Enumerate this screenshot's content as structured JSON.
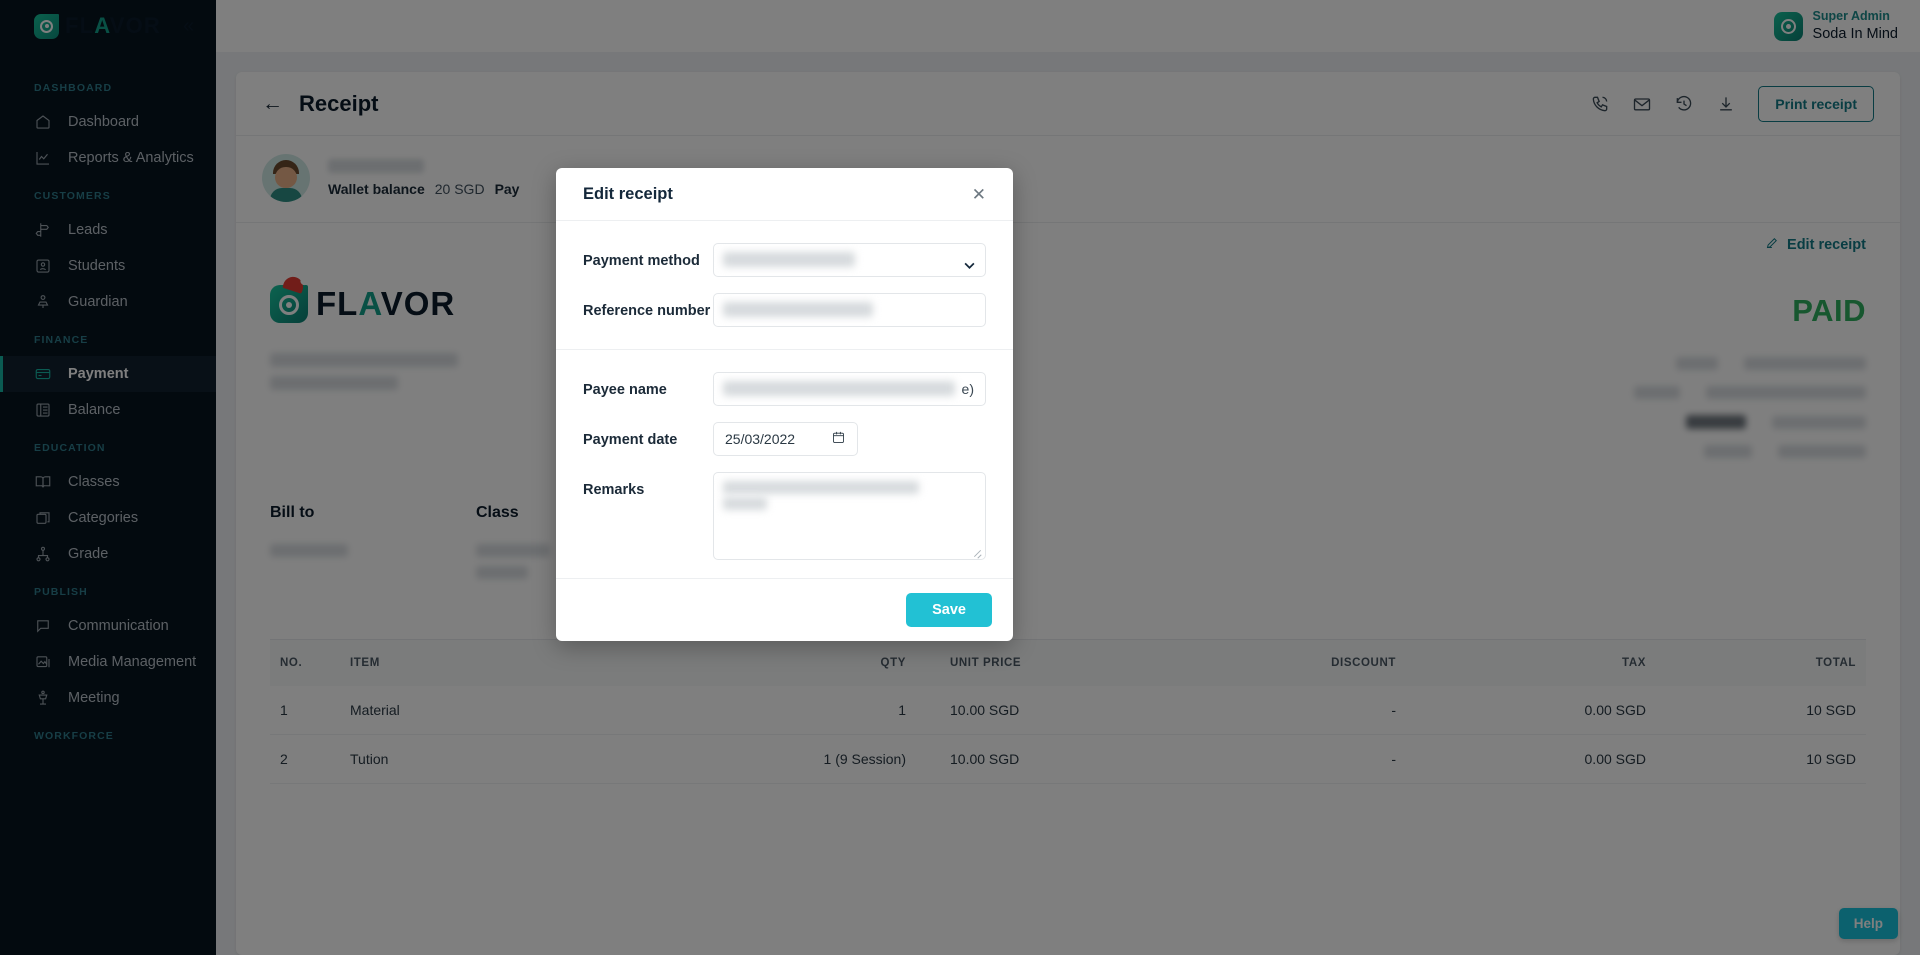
{
  "brand": {
    "name_prefix": "FL",
    "name_accent": "A",
    "name_suffix": "VOR",
    "collapse_glyph": "«"
  },
  "topbar": {
    "user_role": "Super Admin",
    "user_name": "Soda In Mind"
  },
  "sidebar": {
    "groups": [
      {
        "label": "DASHBOARD",
        "items": [
          {
            "label": "Dashboard",
            "icon": "home-icon",
            "active": false
          },
          {
            "label": "Reports & Analytics",
            "icon": "chart-icon",
            "active": false
          }
        ]
      },
      {
        "label": "CUSTOMERS",
        "items": [
          {
            "label": "Leads",
            "icon": "signpost-icon",
            "active": false
          },
          {
            "label": "Students",
            "icon": "id-card-icon",
            "active": false
          },
          {
            "label": "Guardian",
            "icon": "guardian-icon",
            "active": false
          }
        ]
      },
      {
        "label": "FINANCE",
        "items": [
          {
            "label": "Payment",
            "icon": "credit-card-icon",
            "active": true
          },
          {
            "label": "Balance",
            "icon": "ledger-icon",
            "active": false
          }
        ]
      },
      {
        "label": "EDUCATION",
        "items": [
          {
            "label": "Classes",
            "icon": "book-icon",
            "active": false
          },
          {
            "label": "Categories",
            "icon": "boxes-icon",
            "active": false
          },
          {
            "label": "Grade",
            "icon": "hierarchy-icon",
            "active": false
          }
        ]
      },
      {
        "label": "PUBLISH",
        "items": [
          {
            "label": "Communication",
            "icon": "chat-icon",
            "active": false
          },
          {
            "label": "Media Management",
            "icon": "image-icon",
            "active": false
          },
          {
            "label": "Meeting",
            "icon": "podium-icon",
            "active": false
          }
        ]
      },
      {
        "label": "WORKFORCE",
        "items": []
      }
    ]
  },
  "receipt_page": {
    "title": "Receipt",
    "back_icon": "back-arrow-icon",
    "actions": [
      {
        "icon": "phone-icon",
        "name": "call-icon"
      },
      {
        "icon": "mail-icon",
        "name": "email-icon"
      },
      {
        "icon": "history-icon",
        "name": "history-icon"
      },
      {
        "icon": "download-icon",
        "name": "download-icon"
      }
    ],
    "print_button": "Print receipt",
    "customer": {
      "wallet_label": "Wallet balance",
      "wallet_value": "20 SGD",
      "payment_label": "Pay"
    },
    "edit_receipt_link": "Edit receipt",
    "status_badge": "PAID",
    "bill_to_title": "Bill to",
    "class_title": "Class",
    "help_button": "Help"
  },
  "items_table": {
    "columns": [
      "NO.",
      "ITEM",
      "QTY",
      "UNIT PRICE",
      "DISCOUNT",
      "TAX",
      "TOTAL"
    ],
    "rows": [
      {
        "no": "1",
        "item": "Material",
        "qty": "1",
        "unit_price": "10.00 SGD",
        "discount": "-",
        "tax": "0.00 SGD",
        "total": "10 SGD"
      },
      {
        "no": "2",
        "item": "Tution",
        "qty": "1 (9 Session)",
        "unit_price": "10.00 SGD",
        "discount": "-",
        "tax": "0.00 SGD",
        "total": "10 SGD"
      }
    ]
  },
  "modal": {
    "title": "Edit receipt",
    "close_glyph": "✕",
    "fields": {
      "payment_method_label": "Payment method",
      "payment_method_value": "",
      "reference_number_label": "Reference number",
      "reference_number_value": "",
      "payee_name_label": "Payee name",
      "payee_name_value": "e)",
      "payment_date_label": "Payment date",
      "payment_date_value": "25/03/2022",
      "remarks_label": "Remarks",
      "remarks_value": ""
    },
    "save_button": "Save"
  },
  "colors": {
    "accent_teal": "#17b6a5",
    "save_button": "#22c1d4",
    "paid_green": "#2fae5f",
    "link_teal": "#127a86",
    "sidebar_bg": "#06141f"
  }
}
